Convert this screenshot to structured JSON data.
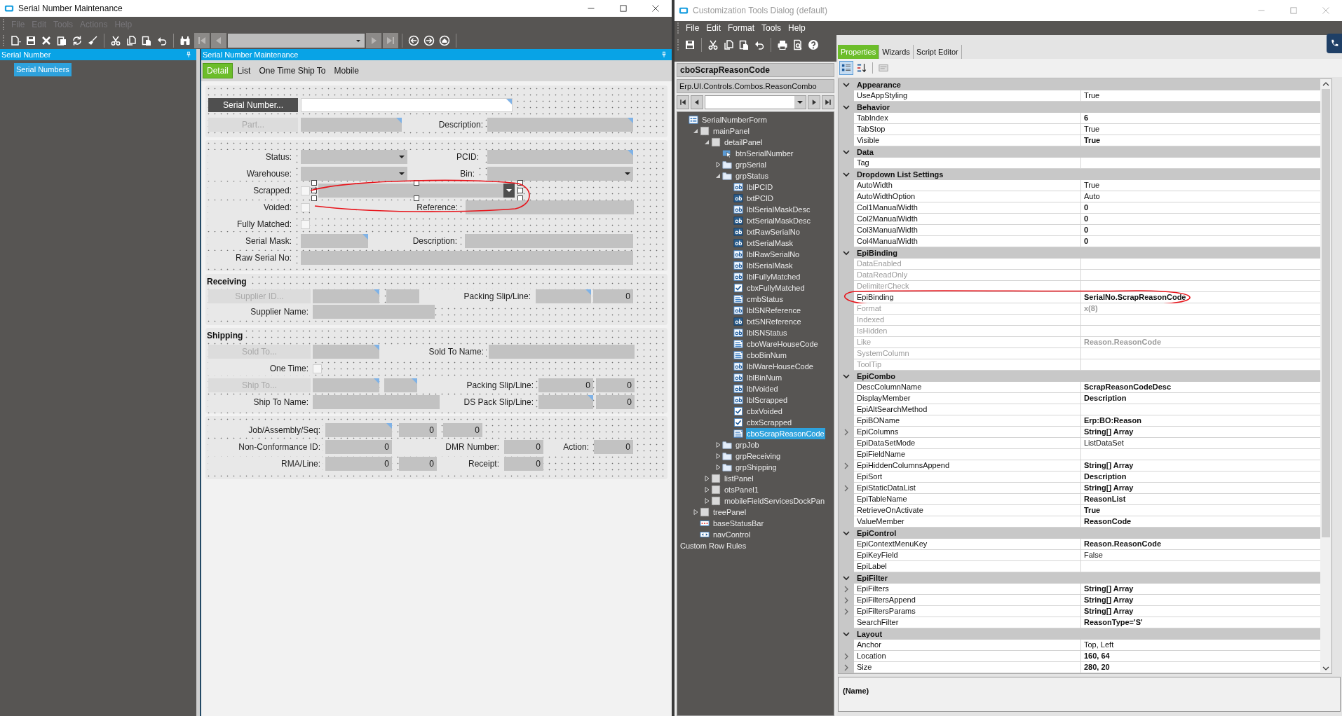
{
  "left_window": {
    "title": "Serial Number Maintenance",
    "menu": [
      {
        "label": "File",
        "disabled": true
      },
      {
        "label": "Edit",
        "disabled": true
      },
      {
        "label": "Tools",
        "disabled": true
      },
      {
        "label": "Actions",
        "disabled": true
      },
      {
        "label": "Help",
        "disabled": true
      }
    ],
    "side_panel": {
      "title": "Serial Number",
      "items": [
        {
          "label": "Serial Numbers",
          "selected": true
        }
      ]
    },
    "main_panel": {
      "title": "Serial Number Maintenance",
      "tabs": [
        {
          "label": "Detail",
          "selected": true
        },
        {
          "label": "List",
          "selected": false
        },
        {
          "label": "One Time Ship To",
          "selected": false
        },
        {
          "label": "Mobile",
          "selected": false
        }
      ],
      "groups": [
        {
          "rows": [
            {
              "items": [
                {
                  "kind": "button",
                  "label": "Serial Number...",
                  "disabled": false
                },
                {
                  "kind": "input",
                  "enabled": true,
                  "lookup": true
                }
              ]
            },
            {
              "items": [
                {
                  "kind": "button",
                  "label": "Part...",
                  "disabled": true
                },
                {
                  "kind": "input",
                  "enabled": false,
                  "lookup": true
                },
                {
                  "kind": "label",
                  "text": "Description:"
                },
                {
                  "kind": "input",
                  "enabled": false,
                  "lookup": true
                }
              ]
            }
          ]
        },
        {
          "rows": [
            {
              "items": [
                {
                  "kind": "label",
                  "text": "Status:"
                },
                {
                  "kind": "combo",
                  "selected": false
                },
                {
                  "kind": "label",
                  "text": "PCID:"
                },
                {
                  "kind": "input",
                  "enabled": false,
                  "lookup": true
                }
              ]
            },
            {
              "items": [
                {
                  "kind": "label",
                  "text": "Warehouse:"
                },
                {
                  "kind": "combo",
                  "selected": false
                },
                {
                  "kind": "label",
                  "text": "Bin:"
                },
                {
                  "kind": "combo",
                  "selected": false
                }
              ]
            },
            {
              "items": [
                {
                  "kind": "label",
                  "text": "Scrapped:"
                },
                {
                  "kind": "checkbox",
                  "checked": false
                },
                {
                  "kind": "combo",
                  "selected": true
                }
              ]
            },
            {
              "items": [
                {
                  "kind": "label",
                  "text": "Voided:"
                },
                {
                  "kind": "checkbox",
                  "checked": false
                },
                {
                  "kind": "label",
                  "text": "Reference:"
                },
                {
                  "kind": "input",
                  "enabled": false,
                  "lookup": false
                }
              ]
            },
            {
              "items": [
                {
                  "kind": "label",
                  "text": "Fully Matched:"
                },
                {
                  "kind": "checkbox",
                  "checked": false
                }
              ]
            },
            {
              "items": [
                {
                  "kind": "label",
                  "text": "Serial Mask:"
                },
                {
                  "kind": "input",
                  "enabled": false,
                  "lookup": true
                },
                {
                  "kind": "label",
                  "text": "Description:"
                },
                {
                  "kind": "input",
                  "enabled": false,
                  "lookup": false
                }
              ]
            },
            {
              "items": [
                {
                  "kind": "label",
                  "text": "Raw Serial No:"
                },
                {
                  "kind": "input",
                  "enabled": false,
                  "lookup": false
                }
              ]
            }
          ]
        },
        {
          "title": "Receiving",
          "rows": [
            {
              "items": [
                {
                  "kind": "button",
                  "label": "Supplier ID...",
                  "disabled": true
                },
                {
                  "kind": "input",
                  "enabled": false,
                  "lookup": true
                },
                {
                  "kind": "input",
                  "enabled": false,
                  "lookup": false
                },
                {
                  "kind": "label",
                  "text": "Packing Slip/Line:"
                },
                {
                  "kind": "input",
                  "enabled": false,
                  "lookup": true
                },
                {
                  "kind": "input",
                  "enabled": false,
                  "lookup": false,
                  "value": "0"
                }
              ]
            },
            {
              "items": [
                {
                  "kind": "label",
                  "text": "Supplier Name:"
                },
                {
                  "kind": "input",
                  "enabled": false,
                  "lookup": false
                }
              ]
            }
          ]
        },
        {
          "title": "Shipping",
          "rows": [
            {
              "items": [
                {
                  "kind": "button",
                  "label": "Sold To...",
                  "disabled": true
                },
                {
                  "kind": "input",
                  "enabled": false,
                  "lookup": true
                },
                {
                  "kind": "label",
                  "text": "Sold To Name:"
                },
                {
                  "kind": "input",
                  "enabled": false,
                  "lookup": false
                }
              ]
            },
            {
              "items": [
                {
                  "kind": "label",
                  "text": "One Time:"
                },
                {
                  "kind": "checkbox",
                  "checked": false
                }
              ]
            },
            {
              "items": [
                {
                  "kind": "button",
                  "label": "Ship To...",
                  "disabled": true
                },
                {
                  "kind": "input",
                  "enabled": false,
                  "lookup": true
                },
                {
                  "kind": "input",
                  "enabled": false,
                  "lookup": true
                },
                {
                  "kind": "label",
                  "text": "Packing Slip/Line:"
                },
                {
                  "kind": "input",
                  "enabled": false,
                  "lookup": false,
                  "value": "0"
                },
                {
                  "kind": "input",
                  "enabled": false,
                  "lookup": false,
                  "value": "0"
                }
              ]
            },
            {
              "items": [
                {
                  "kind": "label",
                  "text": "Ship To Name:"
                },
                {
                  "kind": "input",
                  "enabled": false,
                  "lookup": false
                },
                {
                  "kind": "label",
                  "text": "DS Pack Slip/Line:"
                },
                {
                  "kind": "input",
                  "enabled": false,
                  "lookup": true
                },
                {
                  "kind": "input",
                  "enabled": false,
                  "lookup": false,
                  "value": "0"
                }
              ]
            }
          ]
        },
        {
          "rows": [
            {
              "items": [
                {
                  "kind": "label",
                  "text": "Job/Assembly/Seq:"
                },
                {
                  "kind": "input",
                  "enabled": false,
                  "lookup": true
                },
                {
                  "kind": "input",
                  "enabled": false,
                  "lookup": false,
                  "value": "0"
                },
                {
                  "kind": "input",
                  "enabled": false,
                  "lookup": false,
                  "value": "0"
                }
              ]
            },
            {
              "items": [
                {
                  "kind": "label",
                  "text": "Non-Conformance ID:"
                },
                {
                  "kind": "input",
                  "enabled": false,
                  "lookup": false,
                  "value": "0"
                },
                {
                  "kind": "label",
                  "text": "DMR Number:"
                },
                {
                  "kind": "input",
                  "enabled": false,
                  "lookup": false,
                  "value": "0"
                },
                {
                  "kind": "label",
                  "text": "Action:"
                },
                {
                  "kind": "input",
                  "enabled": false,
                  "lookup": false,
                  "value": "0"
                }
              ]
            },
            {
              "items": [
                {
                  "kind": "label",
                  "text": "RMA/Line:"
                },
                {
                  "kind": "input",
                  "enabled": false,
                  "lookup": false,
                  "value": "0"
                },
                {
                  "kind": "input",
                  "enabled": false,
                  "lookup": false,
                  "value": "0"
                },
                {
                  "kind": "label",
                  "text": "Receipt:"
                },
                {
                  "kind": "input",
                  "enabled": false,
                  "lookup": false,
                  "value": "0"
                }
              ]
            }
          ]
        }
      ]
    }
  },
  "right_window": {
    "title": "Customization Tools Dialog (default)",
    "menu": [
      {
        "label": "File",
        "disabled": false
      },
      {
        "label": "Edit",
        "disabled": false
      },
      {
        "label": "Format",
        "disabled": false
      },
      {
        "label": "Tools",
        "disabled": false
      },
      {
        "label": "Help",
        "disabled": false
      }
    ],
    "selected_control": "cboScrapReasonCode",
    "control_type": "Erp.UI.Controls.Combos.ReasonCombo",
    "tree": [
      {
        "label": "SerialNumberForm",
        "kind": "form",
        "selected": false,
        "children": [
          {
            "label": "mainPanel",
            "kind": "panel",
            "expanded": true,
            "selected": false,
            "children": [
              {
                "label": "detailPanel",
                "kind": "panel",
                "expanded": true,
                "selected": false,
                "children": [
                  {
                    "label": "btnSerialNumber",
                    "kind": "button",
                    "selected": false
                  },
                  {
                    "label": "grpSerial",
                    "kind": "group",
                    "expanded": false,
                    "selected": false
                  },
                  {
                    "label": "grpStatus",
                    "kind": "group",
                    "expanded": true,
                    "selected": false,
                    "children": [
                      {
                        "label": "lblPCID",
                        "kind": "label",
                        "selected": false
                      },
                      {
                        "label": "txtPCID",
                        "kind": "textbox",
                        "selected": false
                      },
                      {
                        "label": "lblSerialMaskDesc",
                        "kind": "label",
                        "selected": false
                      },
                      {
                        "label": "txtSerialMaskDesc",
                        "kind": "textbox",
                        "selected": false
                      },
                      {
                        "label": "txtRawSerialNo",
                        "kind": "textbox",
                        "selected": false
                      },
                      {
                        "label": "txtSerialMask",
                        "kind": "textbox",
                        "selected": false
                      },
                      {
                        "label": "lblRawSerialNo",
                        "kind": "label",
                        "selected": false
                      },
                      {
                        "label": "lblSerialMask",
                        "kind": "label",
                        "selected": false
                      },
                      {
                        "label": "lblFullyMatched",
                        "kind": "label",
                        "selected": false
                      },
                      {
                        "label": "cbxFullyMatched",
                        "kind": "checkbox",
                        "selected": false
                      },
                      {
                        "label": "cmbStatus",
                        "kind": "combo",
                        "selected": false
                      },
                      {
                        "label": "lblSNReference",
                        "kind": "label",
                        "selected": false
                      },
                      {
                        "label": "txtSNReference",
                        "kind": "textbox",
                        "selected": false
                      },
                      {
                        "label": "lblSNStatus",
                        "kind": "label",
                        "selected": false
                      },
                      {
                        "label": "cboWareHouseCode",
                        "kind": "combo",
                        "selected": false
                      },
                      {
                        "label": "cboBinNum",
                        "kind": "combo",
                        "selected": false
                      },
                      {
                        "label": "lblWareHouseCode",
                        "kind": "label",
                        "selected": false
                      },
                      {
                        "label": "lblBinNum",
                        "kind": "label",
                        "selected": false
                      },
                      {
                        "label": "lblVoided",
                        "kind": "label",
                        "selected": false
                      },
                      {
                        "label": "lblScrapped",
                        "kind": "label",
                        "selected": false
                      },
                      {
                        "label": "cbxVoided",
                        "kind": "checkbox",
                        "selected": false
                      },
                      {
                        "label": "cbxScrapped",
                        "kind": "checkbox",
                        "selected": false
                      },
                      {
                        "label": "cboScrapReasonCode",
                        "kind": "combo",
                        "selected": true
                      }
                    ]
                  },
                  {
                    "label": "grpJob",
                    "kind": "group",
                    "expanded": false,
                    "selected": false
                  },
                  {
                    "label": "grpReceiving",
                    "kind": "group",
                    "expanded": false,
                    "selected": false
                  },
                  {
                    "label": "grpShipping",
                    "kind": "group",
                    "expanded": false,
                    "selected": false
                  }
                ]
              },
              {
                "label": "listPanel",
                "kind": "panel",
                "expanded": false,
                "selected": false
              },
              {
                "label": "otsPanel1",
                "kind": "panel",
                "expanded": false,
                "selected": false
              },
              {
                "label": "mobileFieldServicesDockPan",
                "kind": "panel",
                "expanded": false,
                "selected": false
              }
            ]
          },
          {
            "label": "treePanel",
            "kind": "panel",
            "expanded": false,
            "selected": false
          },
          {
            "label": "baseStatusBar",
            "kind": "statusbar",
            "selected": false
          },
          {
            "label": "navControl",
            "kind": "nav",
            "selected": false
          }
        ]
      }
    ],
    "footer_item": "Custom Row Rules",
    "tabs": [
      {
        "label": "Properties",
        "selected": true
      },
      {
        "label": "Wizards",
        "selected": false
      },
      {
        "label": "Script Editor",
        "selected": false
      }
    ],
    "properties": [
      {
        "category": "Appearance",
        "expanded": true,
        "rows": [
          {
            "name": "UseAppStyling",
            "value": "True",
            "bold": false,
            "disabled": false,
            "expandable": false
          }
        ]
      },
      {
        "category": "Behavior",
        "expanded": true,
        "rows": [
          {
            "name": "TabIndex",
            "value": "6",
            "bold": true,
            "disabled": false,
            "expandable": false
          },
          {
            "name": "TabStop",
            "value": "True",
            "bold": false,
            "disabled": false,
            "expandable": false
          },
          {
            "name": "Visible",
            "value": "True",
            "bold": true,
            "disabled": false,
            "expandable": false
          }
        ]
      },
      {
        "category": "Data",
        "expanded": true,
        "rows": [
          {
            "name": "Tag",
            "disabled": false,
            "expandable": false
          }
        ]
      },
      {
        "category": "Dropdown List Settings",
        "expanded": true,
        "rows": [
          {
            "name": "AutoWidth",
            "value": "True",
            "bold": false,
            "disabled": false,
            "expandable": false
          },
          {
            "name": "AutoWidthOption",
            "value": "Auto",
            "bold": false,
            "disabled": false,
            "expandable": false
          },
          {
            "name": "Col1ManualWidth",
            "value": "0",
            "bold": true,
            "disabled": false,
            "expandable": false
          },
          {
            "name": "Col2ManualWidth",
            "value": "0",
            "bold": true,
            "disabled": false,
            "expandable": false
          },
          {
            "name": "Col3ManualWidth",
            "value": "0",
            "bold": true,
            "disabled": false,
            "expandable": false
          },
          {
            "name": "Col4ManualWidth",
            "value": "0",
            "bold": true,
            "disabled": false,
            "expandable": false
          }
        ]
      },
      {
        "category": "EpiBinding",
        "expanded": true,
        "rows": [
          {
            "name": "DataEnabled",
            "disabled": true,
            "expandable": false
          },
          {
            "name": "DataReadOnly",
            "disabled": true,
            "expandable": false
          },
          {
            "name": "DelimiterCheck",
            "disabled": true,
            "expandable": false
          },
          {
            "name": "EpiBinding",
            "value": "SerialNo.ScrapReasonCode",
            "bold": true,
            "disabled": false,
            "expandable": false
          },
          {
            "name": "Format",
            "value": "x(8)",
            "bold": true,
            "disabled": true,
            "expandable": false
          },
          {
            "name": "Indexed",
            "disabled": true,
            "expandable": false
          },
          {
            "name": "IsHidden",
            "disabled": true,
            "expandable": false
          },
          {
            "name": "Like",
            "value": "Reason.ReasonCode",
            "bold": true,
            "disabled": true,
            "expandable": false
          },
          {
            "name": "SystemColumn",
            "disabled": true,
            "expandable": false
          },
          {
            "name": "ToolTip",
            "disabled": true,
            "expandable": false
          }
        ]
      },
      {
        "category": "EpiCombo",
        "expanded": true,
        "rows": [
          {
            "name": "DescColumnName",
            "value": "ScrapReasonCodeDesc",
            "bold": true,
            "disabled": false,
            "expandable": false
          },
          {
            "name": "DisplayMember",
            "value": "Description",
            "bold": true,
            "disabled": false,
            "expandable": false
          },
          {
            "name": "EpiAltSearchMethod",
            "disabled": false,
            "expandable": false
          },
          {
            "name": "EpiBOName",
            "value": "Erp:BO:Reason",
            "bold": true,
            "disabled": false,
            "expandable": false
          },
          {
            "name": "EpiColumns",
            "value": "String[] Array",
            "bold": true,
            "disabled": false,
            "expandable": true
          },
          {
            "name": "EpiDataSetMode",
            "value": "ListDataSet",
            "bold": false,
            "disabled": false,
            "expandable": false
          },
          {
            "name": "EpiFieldName",
            "disabled": false,
            "expandable": false
          },
          {
            "name": "EpiHiddenColumnsAppend",
            "value": "String[] Array",
            "bold": true,
            "disabled": false,
            "expandable": true
          },
          {
            "name": "EpiSort",
            "value": "Description",
            "bold": true,
            "disabled": false,
            "expandable": false
          },
          {
            "name": "EpiStaticDataList",
            "value": "String[] Array",
            "bold": true,
            "disabled": false,
            "expandable": true
          },
          {
            "name": "EpiTableName",
            "value": "ReasonList",
            "bold": true,
            "disabled": false,
            "expandable": false
          },
          {
            "name": "RetrieveOnActivate",
            "value": "True",
            "bold": true,
            "disabled": false,
            "expandable": false
          },
          {
            "name": "ValueMember",
            "value": "ReasonCode",
            "bold": true,
            "disabled": false,
            "expandable": false
          }
        ]
      },
      {
        "category": "EpiControl",
        "expanded": true,
        "rows": [
          {
            "name": "EpiContextMenuKey",
            "value": "Reason.ReasonCode",
            "bold": true,
            "disabled": false,
            "expandable": false
          },
          {
            "name": "EpiKeyField",
            "value": "False",
            "bold": false,
            "disabled": false,
            "expandable": false
          },
          {
            "name": "EpiLabel",
            "disabled": false,
            "expandable": false
          }
        ]
      },
      {
        "category": "EpiFilter",
        "expanded": true,
        "rows": [
          {
            "name": "EpiFilters",
            "value": "String[] Array",
            "bold": true,
            "disabled": false,
            "expandable": true
          },
          {
            "name": "EpiFiltersAppend",
            "value": "String[] Array",
            "bold": true,
            "disabled": false,
            "expandable": true
          },
          {
            "name": "EpiFiltersParams",
            "value": "String[] Array",
            "bold": true,
            "disabled": false,
            "expandable": true
          },
          {
            "name": "SearchFilter",
            "value": "ReasonType='S'",
            "bold": true,
            "disabled": false,
            "expandable": false
          }
        ]
      },
      {
        "category": "Layout",
        "expanded": true,
        "rows": [
          {
            "name": "Anchor",
            "value": "Top, Left",
            "bold": false,
            "disabled": false,
            "expandable": false
          },
          {
            "name": "Location",
            "value": "160, 64",
            "bold": true,
            "disabled": false,
            "expandable": true
          },
          {
            "name": "Size",
            "value": "280, 20",
            "bold": true,
            "disabled": false,
            "expandable": true
          }
        ]
      }
    ],
    "description": {
      "title": "(Name)"
    }
  }
}
